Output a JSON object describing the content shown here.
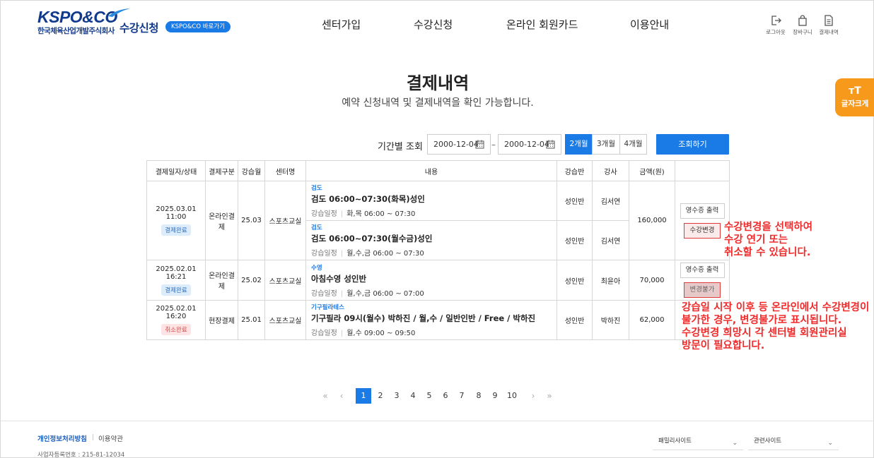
{
  "header": {
    "logo_text": "KSPO&CO",
    "logo_company": "한국체육산업개발주식회사",
    "site_title": "수강신청",
    "goto_label": "KSPO&CO 바로가기",
    "nav": [
      "센터가입",
      "수강신청",
      "온라인 회원카드",
      "이용안내"
    ],
    "utils": [
      {
        "label": "로그아웃",
        "icon": "logout-icon"
      },
      {
        "label": "장바구니",
        "icon": "cart-icon"
      },
      {
        "label": "결제내역",
        "icon": "document-icon"
      }
    ],
    "font_size_tab": {
      "glyph": "ᴛT",
      "label": "글자크게"
    }
  },
  "page": {
    "title": "결제내역",
    "description": "예약 신청내역 및 결제내역을 확인 가능합니다."
  },
  "filter": {
    "label": "기간별 조회",
    "start_date": "2000-12-04",
    "end_date": "2000-12-04",
    "dash": "–",
    "periods": [
      "2개월",
      "3개월",
      "4개월"
    ],
    "active_period": "2개월",
    "search_label": "조회하기"
  },
  "table": {
    "headers": [
      "결제일자/상태",
      "결제구분",
      "강습월",
      "센터명",
      "내용",
      "강습반",
      "강사",
      "금액(원)",
      ""
    ],
    "schedule_key": "강습일정",
    "orders": [
      {
        "date": "2025.03.01 11:00",
        "status": "결제완료",
        "pay_type": "온라인결제",
        "month": "25.03",
        "center": "스포츠교실",
        "amount": "160,000",
        "receipt_label": "영수증 출력",
        "change_label": "수강변경",
        "items": [
          {
            "category": "검도",
            "name": "검도 06:00~07:30(화목)성인",
            "schedule": "화,목 06:00 ~ 07:30",
            "class": "성인반",
            "instructor": "김서연"
          },
          {
            "category": "검도",
            "name": "검도 06:00~07:30(월수금)성인",
            "schedule": "월,수,금 06:00 ~ 07:30",
            "class": "성인반",
            "instructor": "김서연"
          }
        ]
      },
      {
        "date": "2025.02.01 16:21",
        "status": "결제완료",
        "pay_type": "온라인결제",
        "month": "25.02",
        "center": "스포츠교실",
        "amount": "70,000",
        "receipt_label": "영수증 출력",
        "change_label": "변경불가",
        "items": [
          {
            "category": "수영",
            "name": "아침수영 성인반",
            "schedule": "월,수,금 06:00 ~ 07:00",
            "class": "성인반",
            "instructor": "최윤아"
          }
        ]
      },
      {
        "date": "2025.02.01 16:20",
        "status": "취소완료",
        "pay_type": "현장결제",
        "month": "25.01",
        "center": "스포츠교실",
        "amount": "62,000",
        "items": [
          {
            "category": "기구필라테스",
            "name": "기구필라 09시(월수) 박하진 / 월,수 / 일반인반 / Free / 박하진",
            "schedule": "월,수 09:00 ~ 09:50",
            "class": "성인반",
            "instructor": "박하진"
          }
        ]
      }
    ]
  },
  "annotations": {
    "note1": [
      "수강변경을 선택하여",
      "수강 연기 또는",
      "취소할 수 있습니다."
    ],
    "note2": [
      "강습일 시작 이후 등 온라인에서 수강변경이",
      "불가한 경우, 변경불가로 표시됩니다.",
      "수강변경 희망시 각 센터별 회원관리실",
      "방문이 필요합니다."
    ]
  },
  "pagination": {
    "first": "«",
    "prev": "‹",
    "pages": [
      "1",
      "2",
      "3",
      "4",
      "5",
      "6",
      "7",
      "8",
      "9",
      "10"
    ],
    "current": "1",
    "next": "›",
    "last": "»"
  },
  "footer": {
    "privacy": "개인정보처리방침",
    "terms": "이용약관",
    "biz_no": "사업자등록번호 : 215-81-12034",
    "selects": [
      "패밀리사이트",
      "관련사이트"
    ]
  },
  "colors": {
    "accent": "#1a7ae6",
    "brand": "#123a8c",
    "annotation": "#ef2b2b",
    "font_tab": "#f79a1c"
  }
}
